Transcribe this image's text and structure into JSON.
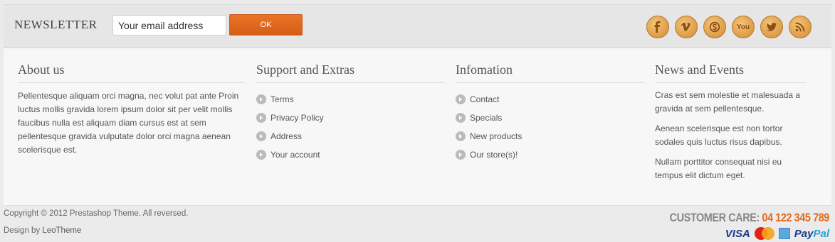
{
  "newsletter": {
    "title": "NEWSLETTER",
    "email_placeholder": "Your email address",
    "submit_label": "OK"
  },
  "social": [
    {
      "name": "facebook-icon",
      "glyph": "f"
    },
    {
      "name": "vimeo-icon",
      "glyph": "v"
    },
    {
      "name": "skype-icon",
      "glyph": "s"
    },
    {
      "name": "youtube-icon",
      "glyph": "You"
    },
    {
      "name": "twitter-icon",
      "glyph": "bird"
    },
    {
      "name": "rss-icon",
      "glyph": "rss"
    }
  ],
  "about": {
    "title": "About us",
    "text": "Pellentesque aliquam orci magna, nec volut pat ante Proin luctus mollis gravida lorem ipsum dolor sit per velit mollis faucibus nulla est aliquam diam cursus est at sem pellentesque gravida vulputate dolor orci magna aenean scelerisque est."
  },
  "support": {
    "title": "Support and Extras",
    "links": [
      "Terms",
      "Privacy Policy",
      "Address",
      "Your account"
    ]
  },
  "info": {
    "title": "Infomation",
    "links": [
      "Contact",
      "Specials",
      "New products",
      "Our store(s)!"
    ]
  },
  "news": {
    "title": "News and Events",
    "items": [
      "Cras est sem molestie et malesuada a gravida at sem pellentesque.",
      "Aenean scelerisque est non tortor sodales quis luctus risus dapibus.",
      "Nullam porttitor consequat nisi eu tempus elit dictum eget."
    ]
  },
  "footer": {
    "copyright": "Copyright © 2012 Prestashop Theme. All reversed.",
    "design_prefix": "Design by ",
    "design_link": "LeoTheme",
    "care_label": "CUSTOMER CARE: ",
    "care_number": "04 122 345 789",
    "payments": {
      "visa": "VISA",
      "paypal_pay": "Pay",
      "paypal_pal": "Pal"
    }
  },
  "colors": {
    "accent": "#e66a1e",
    "button": "#d9621b",
    "social_gold": "#dc9c44"
  }
}
